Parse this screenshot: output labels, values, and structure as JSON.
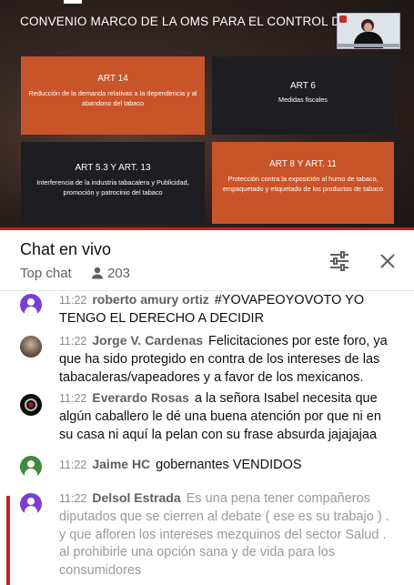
{
  "video": {
    "title": "CONVENIO MARCO DE LA OMS PARA EL CONTROL DE",
    "cards": [
      {
        "title": "ART 14",
        "desc": "Reducción de la demanda relativas a la dependencia y al abandono del tabaco",
        "color": "#c9542a"
      },
      {
        "title": "ART 6",
        "desc": "Medidas fiscales",
        "color": "#1e1e22"
      },
      {
        "title": "ART 5.3 Y ART. 13",
        "desc": "Interferencia de la industria tabacalera y Publicidad, promoción y patrocinio del tabaco",
        "color": "#1e1e22"
      },
      {
        "title": "ART 8 Y ART. 11",
        "desc": "Protección contra la exposición al humo de tabaco, empaquetado y etiquetado de los productos de tabaco",
        "color": "#c9542a"
      }
    ]
  },
  "chat": {
    "title": "Chat en vivo",
    "mode": "Top chat",
    "viewers": "203",
    "icons": {
      "viewers": "person-icon",
      "settings": "tune-icon",
      "close": "close-icon"
    }
  },
  "messages": [
    {
      "time": "11:22",
      "author": "roberto amury ortiz",
      "text": "#YOVAPEOYOVOTO YO TENGO EL DERECHO A DECIDIR",
      "avatar": "purple-generic"
    },
    {
      "time": "11:22",
      "author": "Jorge V. Cardenas",
      "text": "Felicitaciones por este foro, ya que ha sido protegido en contra de los intereses de las tabacaleras/vapeadores y a favor de los mexicanos.",
      "avatar": "photo"
    },
    {
      "time": "11:22",
      "author": "Everardo Rosas",
      "text": "a la señora Isabel necesita que algún caballero le dé una buena atención por que ni en su casa ni aquí la pelan con su frase absurda jajajajaa",
      "avatar": "emblem"
    },
    {
      "time": "11:22",
      "author": "Jaime HC",
      "text": "gobernantes VENDIDOS",
      "avatar": "green-generic"
    },
    {
      "time": "11:22",
      "author": "Delsol Estrada",
      "text": "Es una pena tener compañeros diputados que se cierren al debate ( ese es su trabajo ) . y que afloren los intereses mezquinos del sector Salud . al prohibirle una opción sana y de vida para los consumidores",
      "avatar": "purple-generic"
    }
  ],
  "colors": {
    "accent_red": "#cc1f1f",
    "orange": "#c9542a"
  }
}
